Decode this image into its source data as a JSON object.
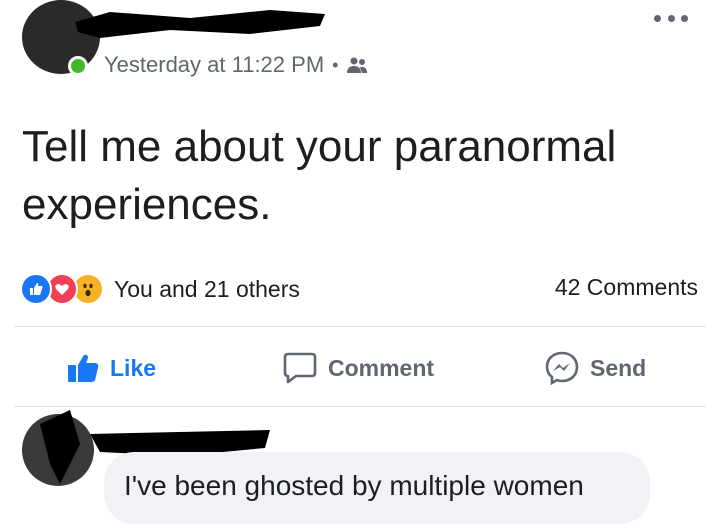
{
  "post": {
    "timestamp": "Yesterday at 11:22 PM",
    "separator": "•",
    "privacy_icon": "friends-icon",
    "text_line1": "Tell me about your paranormal",
    "text_line2": "experiences."
  },
  "reactions": {
    "icons": [
      "like-reaction-icon",
      "love-reaction-icon",
      "wow-reaction-icon"
    ],
    "summary": "You and 21 others",
    "comments_count": "42 Comments"
  },
  "actions": {
    "like_label": "Like",
    "comment_label": "Comment",
    "send_label": "Send"
  },
  "comment": {
    "text": "I've been ghosted by multiple women"
  },
  "colors": {
    "like_blue": "#1877f2",
    "online_green": "#42b72a",
    "muted_text": "#606770",
    "bubble_bg": "#f0f2f5"
  }
}
